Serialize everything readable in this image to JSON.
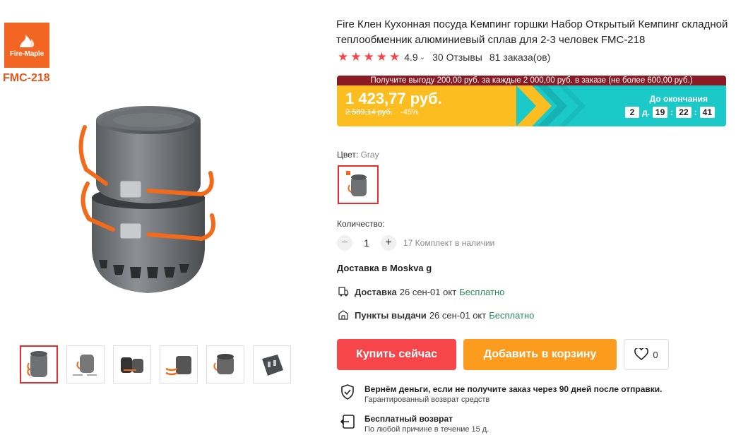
{
  "brand": {
    "logo_text": "Fire-Maple",
    "model": "FMC-218"
  },
  "product": {
    "title": "Fire Клен Кухонная посуда Кемпинг горшки Набор Открытый Кемпинг складной теплообменник алюминиевый сплав для 2-3 человек FMC-218",
    "rating": "4.9",
    "reviews": "30 Отзывы",
    "orders": "81 заказа(ов)"
  },
  "promo": {
    "banner": "Получите выгоду 200,00 руб. за каждые 2 000,00 руб. в заказе (не более 600,00 руб.)",
    "price": "1 423,77 руб.",
    "old_price": "2 589,14 руб.",
    "discount": "-45%",
    "countdown_label": "До окончания",
    "days": "2",
    "days_unit": "д.",
    "hours": "19",
    "minutes": "22",
    "seconds": "41",
    "colors": {
      "banner": "#8a1a24",
      "price_bg": "#fbbd1f",
      "countdown_bg": "#1bc9c8"
    }
  },
  "color": {
    "label": "Цвет:",
    "value": "Gray"
  },
  "quantity": {
    "label": "Количество:",
    "minus": "−",
    "value": "1",
    "plus": "+",
    "stock": "17 Комплект в наличии"
  },
  "delivery": {
    "heading": "Доставка в Moskva g",
    "rows": [
      {
        "icon": "truck-icon",
        "title": "Доставка",
        "date": "26 сен-01 окт",
        "price": "Бесплатно"
      },
      {
        "icon": "pickup-icon",
        "title": "Пункты выдачи",
        "date": "26 сен-01 окт",
        "price": "Бесплатно"
      }
    ]
  },
  "actions": {
    "buy": "Купить сейчас",
    "cart": "Добавить в корзину",
    "wish_count": "0",
    "colors": {
      "buy": "#f6464a",
      "cart": "#fb9c1f"
    }
  },
  "guarantees": [
    {
      "icon": "shield-check-icon",
      "title": "Вернём деньги, если не получите заказ через 90 дней после отправки.",
      "sub": "Гарантированный возврат средств"
    },
    {
      "icon": "return-icon",
      "title": "Бесплатный возврат",
      "sub": "По любой причине в течение 15 д."
    }
  ]
}
